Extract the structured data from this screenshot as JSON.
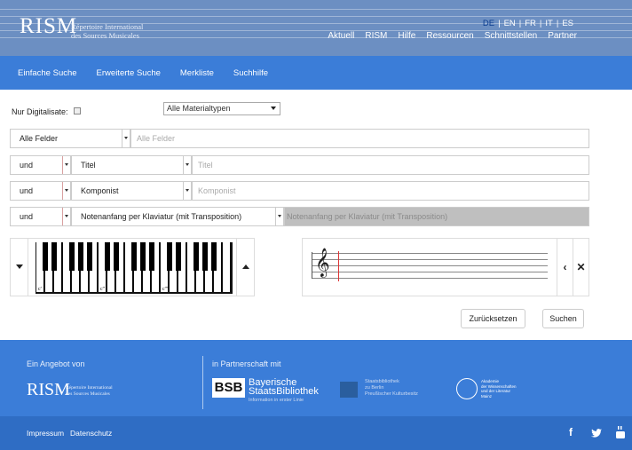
{
  "header": {
    "logo": "RISM",
    "subtitle_line1": "Répertoire International",
    "subtitle_line2": "des Sources Musicales",
    "languages": [
      "DE",
      "EN",
      "FR",
      "IT",
      "ES"
    ],
    "active_language": "DE",
    "nav": [
      "Aktuell",
      "RISM",
      "Hilfe",
      "Ressourcen",
      "Schnittstellen",
      "Partner"
    ]
  },
  "mainnav": {
    "items": [
      "Einfache Suche",
      "Erweiterte Suche",
      "Merkliste",
      "Suchhilfe"
    ]
  },
  "form": {
    "digitalisate_label": "Nur Digitalisate:",
    "digitalisate_checked": false,
    "material_type": "Alle Materialtypen",
    "rows": [
      {
        "operator": "",
        "field": "Alle Felder",
        "placeholder": "Alle Felder"
      },
      {
        "operator": "und",
        "field": "Titel",
        "placeholder": "Titel"
      },
      {
        "operator": "und",
        "field": "Komponist",
        "placeholder": "Komponist"
      },
      {
        "operator": "und",
        "field": "Notenanfang per Klaviatur (mit Transposition)",
        "placeholder": "Notenanfang per Klaviatur (mit Transposition)"
      }
    ],
    "keyboard_labels": [
      "c'",
      "c''",
      "c'''"
    ],
    "reset_label": "Zurücksetzen",
    "search_label": "Suchen"
  },
  "footer": {
    "offered_by": "Ein Angebot von",
    "partnership": "in Partnerschaft mit",
    "rism_logo": "RISM",
    "rism_sub1": "Répertoire International",
    "rism_sub2": "des Sources Musicales",
    "bsb_mark": "BSB",
    "bsb_line1": "Bayerische",
    "bsb_line2": "StaatsBibliothek",
    "bsb_tagline": "Information in erster Linie",
    "sbb_line1": "Staatsbibliothek",
    "sbb_line2": "zu Berlin",
    "sbb_line3": "Preußischer Kulturbesitz",
    "adw_line1": "Akademie",
    "adw_line2": "der Wissenschaften",
    "adw_line3": "und der Literatur",
    "adw_line4": "Mainz",
    "links": [
      "Impressum",
      "Datenschutz"
    ],
    "social_icons": [
      "facebook-icon",
      "twitter-icon",
      "youtube-icon"
    ]
  }
}
